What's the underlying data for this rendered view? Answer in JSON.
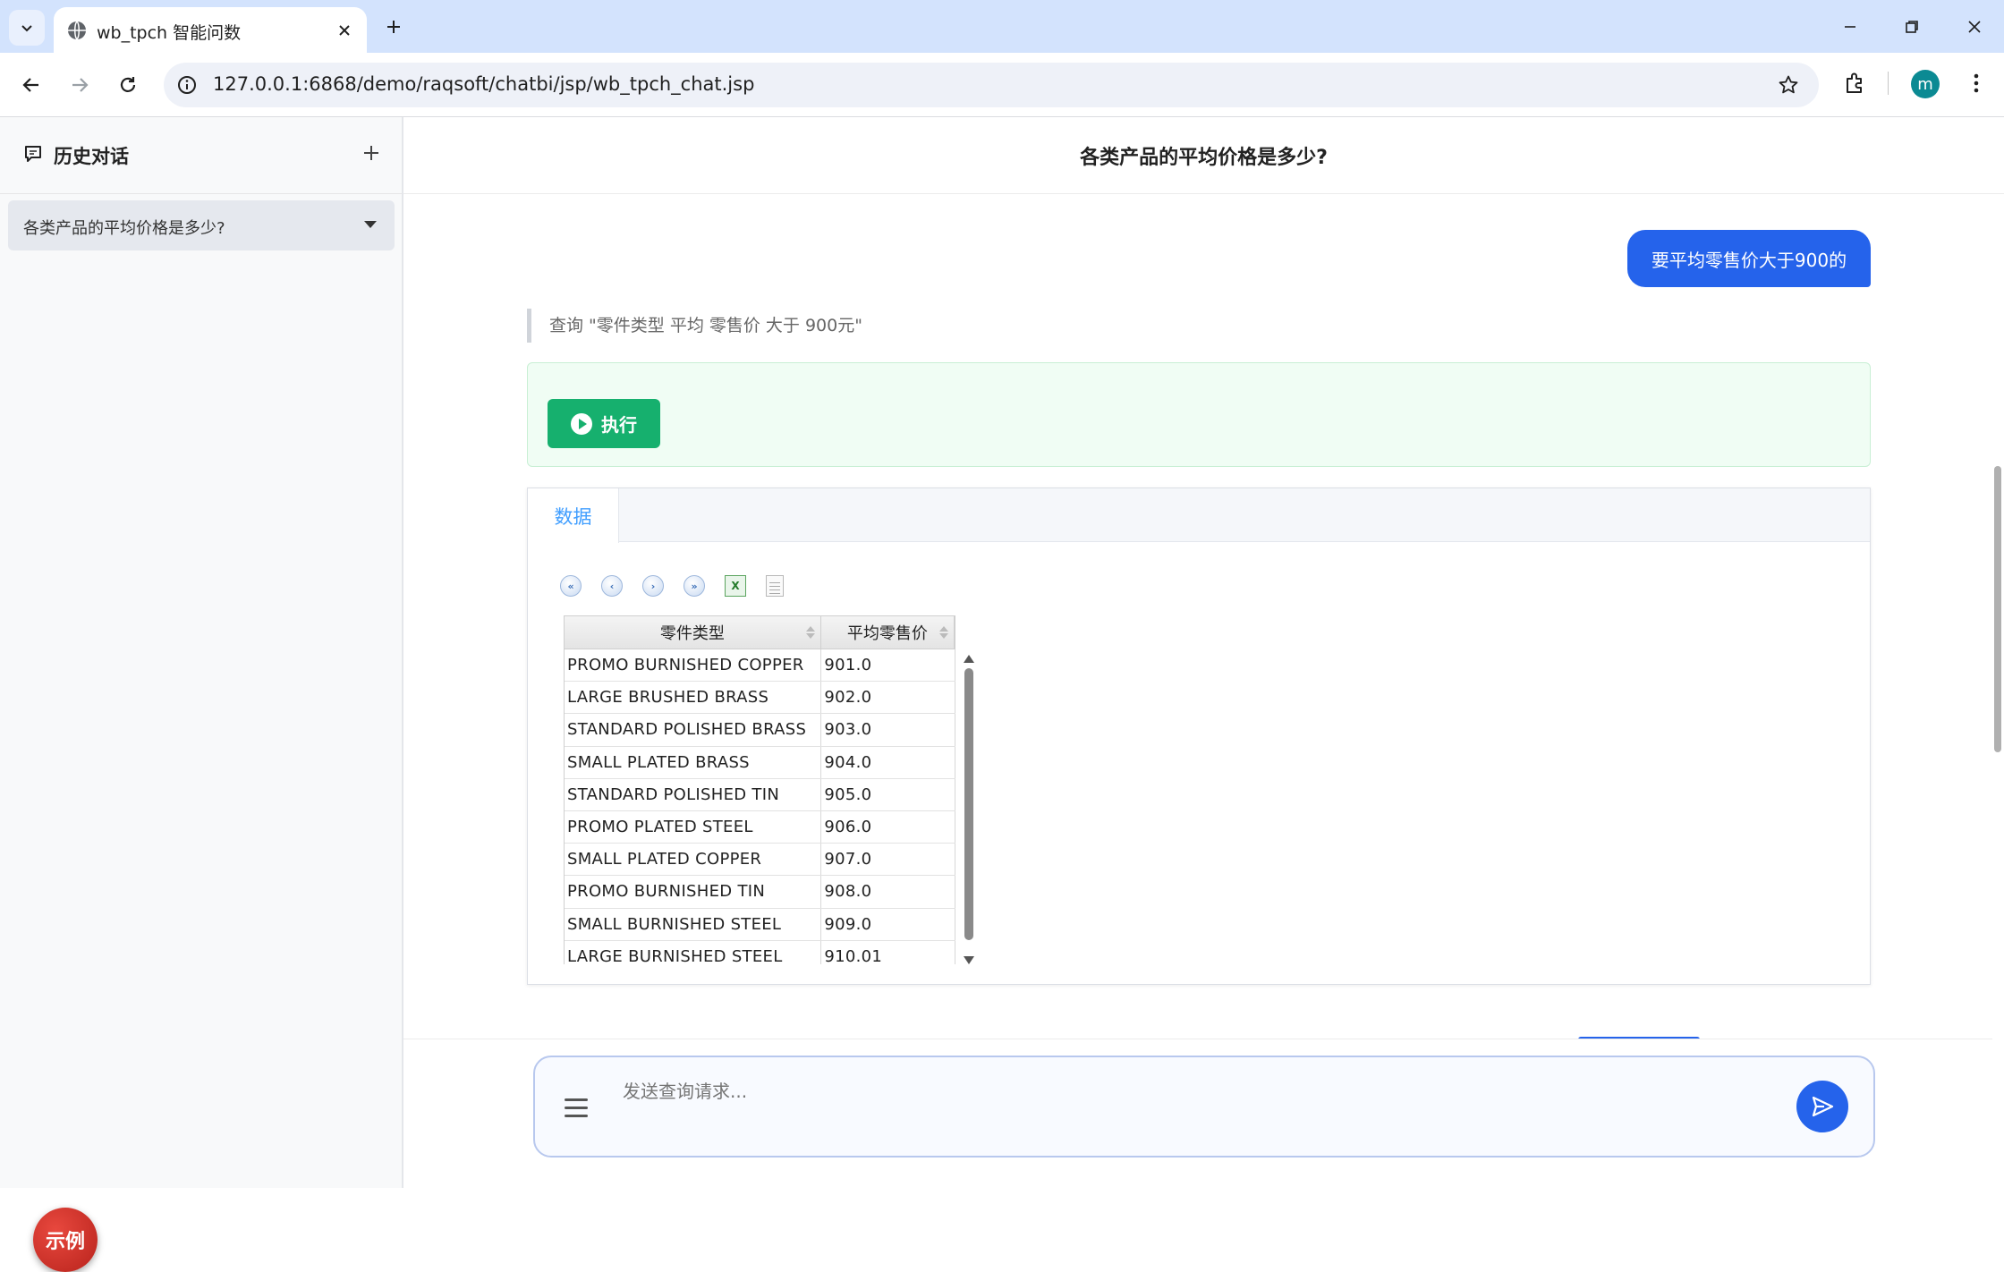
{
  "browser": {
    "tab_title": "wb_tpch 智能问数",
    "url": "127.0.0.1:6868/demo/raqsoft/chatbi/jsp/wb_tpch_chat.jsp",
    "profile_initial": "m"
  },
  "sidebar": {
    "title": "历史对话",
    "items": [
      {
        "label": "各类产品的平均价格是多少?"
      }
    ],
    "example_button": "示例"
  },
  "main": {
    "title": "各类产品的平均价格是多少?",
    "user_message": "要平均零售价大于900的",
    "query_note": "查询 \"零件类型 平均 零售价 大于 900元\"",
    "execute_label": "执行",
    "tabs": [
      {
        "label": "数据"
      }
    ],
    "grid": {
      "columns": [
        "零件类型",
        "平均零售价"
      ],
      "rows": [
        [
          "PROMO BURNISHED COPPER",
          "901.0"
        ],
        [
          "LARGE BRUSHED BRASS",
          "902.0"
        ],
        [
          "STANDARD POLISHED BRASS",
          "903.0"
        ],
        [
          "SMALL PLATED BRASS",
          "904.0"
        ],
        [
          "STANDARD POLISHED TIN",
          "905.0"
        ],
        [
          "PROMO PLATED STEEL",
          "906.0"
        ],
        [
          "SMALL PLATED COPPER",
          "907.0"
        ],
        [
          "PROMO BURNISHED TIN",
          "908.0"
        ],
        [
          "SMALL BURNISHED STEEL",
          "909.0"
        ],
        [
          "LARGE BURNISHED STEEL",
          "910.01"
        ]
      ]
    },
    "input": {
      "placeholder": "发送查询请求..."
    }
  },
  "colors": {
    "accent": "#2563eb",
    "execute": "#16b06e",
    "tab_active": "#409eff",
    "example": "#c62828"
  }
}
